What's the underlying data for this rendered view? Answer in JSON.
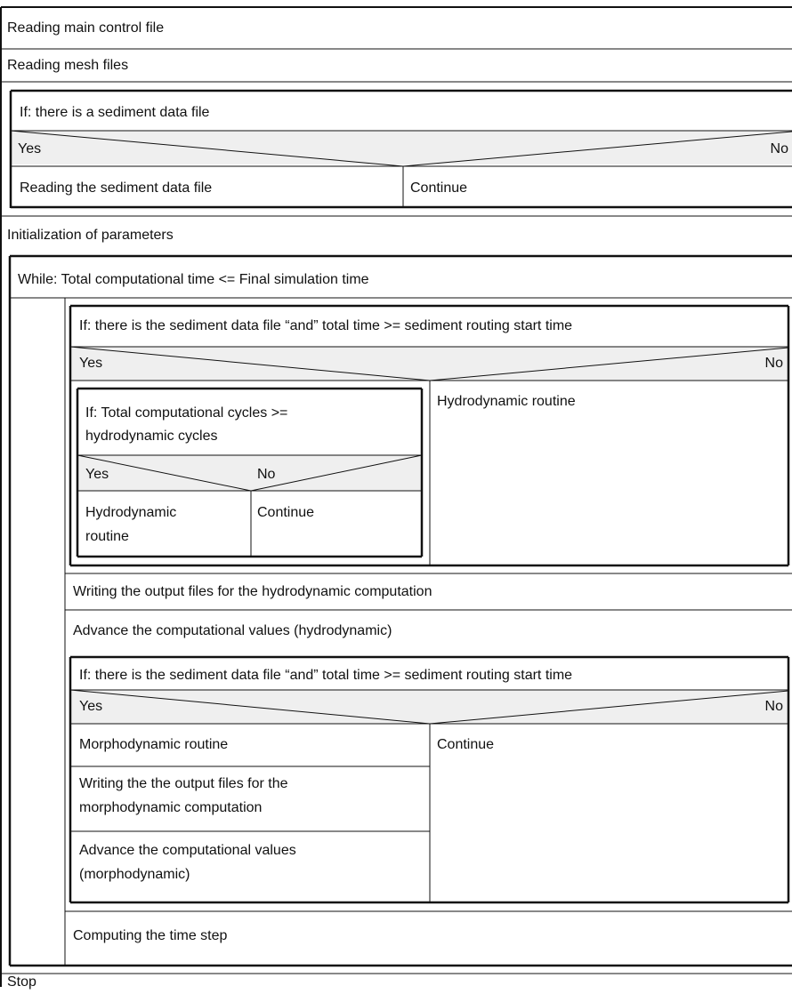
{
  "steps": {
    "read_control": "Reading main control file",
    "read_mesh": "Reading mesh files",
    "init_params": "Initialization of  parameters",
    "stop": "Stop"
  },
  "if_sediment_file": {
    "condition": "If: there is a sediment data file",
    "yes": "Yes",
    "no": "No",
    "yes_action": "Reading the sediment data file",
    "no_action": "Continue"
  },
  "while_loop": {
    "condition": "While: Total computational time <= Final simulation time",
    "if_routing_1": {
      "condition": "If: there is the sediment data file “and” total time >= sediment routing start time",
      "yes": "Yes",
      "no": "No",
      "no_action": "Hydrodynamic routine",
      "if_cycles": {
        "condition_line1": "If: Total computational cycles >=",
        "condition_line2": "hydrodynamic cycles",
        "yes": "Yes",
        "no": "No",
        "yes_action_line1": "Hydrodynamic",
        "yes_action_line2": "routine",
        "no_action": "Continue"
      }
    },
    "write_hydro": "Writing the output files for the hydrodynamic computation",
    "advance_hydro": "Advance the computational values (hydrodynamic)",
    "if_routing_2": {
      "condition": "If: there is the sediment data file “and” total time >= sediment routing start time",
      "yes": "Yes",
      "no": "No",
      "yes_actions": [
        "Morphodynamic routine",
        "Writing the the output files for the",
        "morphodynamic computation",
        "Advance the computational values",
        "(morphodynamic)"
      ],
      "no_action": "Continue"
    },
    "time_step": "Computing the time step"
  }
}
